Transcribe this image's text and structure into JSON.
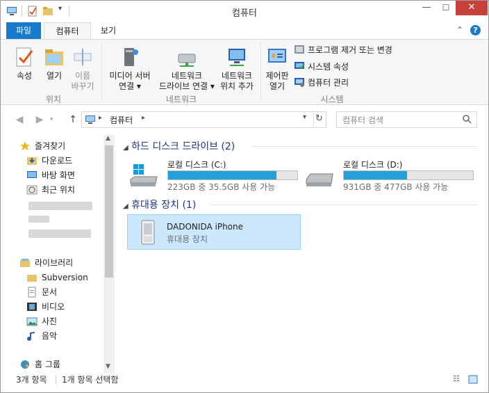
{
  "window": {
    "title": "컴퓨터"
  },
  "ribbon_tabs": {
    "file": "파일",
    "computer": "컴퓨터",
    "view": "보기"
  },
  "ribbon": {
    "properties": "속성",
    "open": "열기",
    "rename_line1": "이름",
    "rename_line2": "바꾸기",
    "group_location": "위치",
    "media_line1": "미디어 서버",
    "media_line2": "연결 ▾",
    "map_line1": "네트워크",
    "map_line2": "드라이브 연결 ▾",
    "add_line1": "네트워크",
    "add_line2": "위치 추가",
    "group_network": "네트워크",
    "cp_line1": "제어판",
    "cp_line2": "열기",
    "uninstall": "프로그램 제거 또는 변경",
    "sys_props": "시스템 속성",
    "manage": "컴퓨터 관리",
    "group_system": "시스템"
  },
  "address": {
    "crumb": "컴퓨터"
  },
  "search": {
    "placeholder": "컴퓨터 검색"
  },
  "nav": {
    "favorites": "즐겨찾기",
    "downloads": "다운로드",
    "desktop": "바탕 화면",
    "recent": "최근 위치",
    "libraries": "라이브러리",
    "subversion": "Subversion",
    "documents": "문서",
    "videos": "비디오",
    "pictures": "사진",
    "music": "음악",
    "homegroup": "홈 그룹"
  },
  "content": {
    "hdd_group": "하드 디스크 드라이브 (2)",
    "drives": [
      {
        "name": "로컬 디스크 (C:)",
        "info": "223GB 중 35.5GB 사용 가능",
        "used_fraction": 0.84
      },
      {
        "name": "로컬 디스크 (D:)",
        "info": "931GB 중 477GB 사용 가능",
        "used_fraction": 0.49
      }
    ],
    "portable_group": "휴대용 장치 (1)",
    "device": {
      "name": "DADONIDA iPhone",
      "type": "휴대용 장치"
    }
  },
  "status": {
    "count": "3개 항목",
    "selected": "1개 항목 선택함"
  },
  "colors": {
    "accent": "#1979ca",
    "bar_fill": "#26a0da",
    "selection": "#cce8ff",
    "close": "#c7413a"
  }
}
